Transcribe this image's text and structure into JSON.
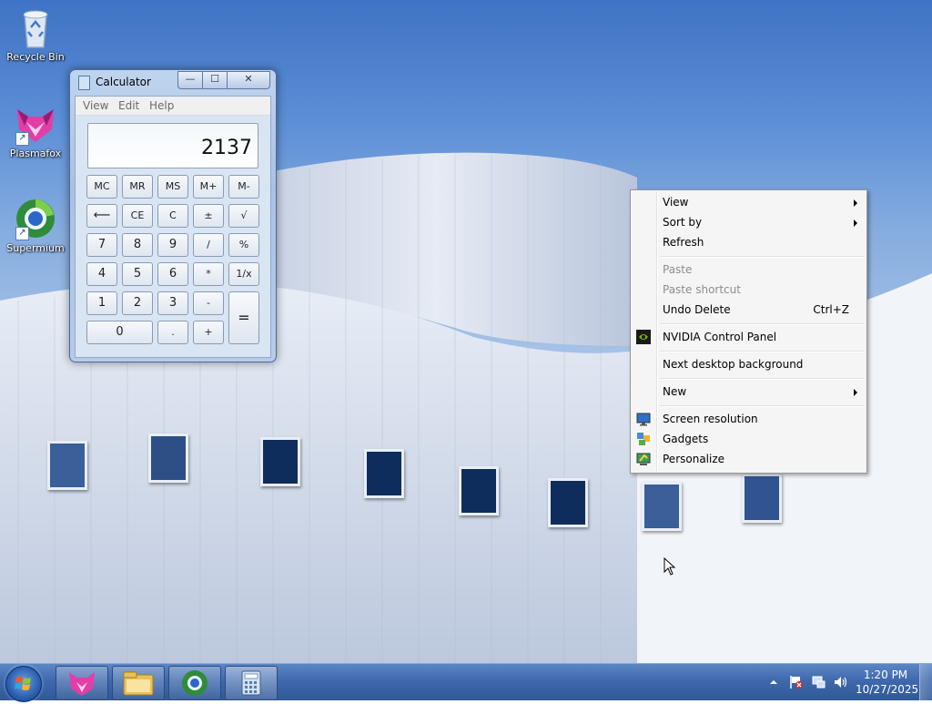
{
  "desktop_icons": [
    {
      "label": "Recycle Bin",
      "icon": "recycle-bin-icon"
    },
    {
      "label": "Plasmafox",
      "icon": "plasmafox-icon"
    },
    {
      "label": "Supermium",
      "icon": "supermium-icon"
    }
  ],
  "calculator": {
    "title": "Calculator",
    "caption_buttons": {
      "minimize": "—",
      "maximize": "☐",
      "close": "✕"
    },
    "menu": [
      "View",
      "Edit",
      "Help"
    ],
    "display": "2137",
    "keys": {
      "mc": "MC",
      "mr": "MR",
      "ms": "MS",
      "mplus": "M+",
      "mminus": "M-",
      "backspace": "⟵",
      "ce": "CE",
      "c": "C",
      "plusminus": "±",
      "sqrt": "√",
      "k7": "7",
      "k8": "8",
      "k9": "9",
      "div": "/",
      "pct": "%",
      "k4": "4",
      "k5": "5",
      "k6": "6",
      "mul": "*",
      "recip": "1/x",
      "k1": "1",
      "k2": "2",
      "k3": "3",
      "sub": "-",
      "eq": "=",
      "k0": "0",
      "dot": ".",
      "add": "+"
    }
  },
  "context_menu": {
    "view": "View",
    "sort_by": "Sort by",
    "refresh": "Refresh",
    "paste": "Paste",
    "paste_shortcut": "Paste shortcut",
    "undo_delete": "Undo Delete",
    "undo_shortcut": "Ctrl+Z",
    "nvidia": "NVIDIA Control Panel",
    "next_bg": "Next desktop background",
    "new": "New",
    "screen_resolution": "Screen resolution",
    "gadgets": "Gadgets",
    "personalize": "Personalize"
  },
  "taskbar": {
    "pinned": [
      "plasmafox-icon",
      "file-explorer-icon",
      "supermium-icon",
      "calculator-icon"
    ],
    "clock_time": "1:20 PM",
    "clock_date": "10/27/2025"
  }
}
